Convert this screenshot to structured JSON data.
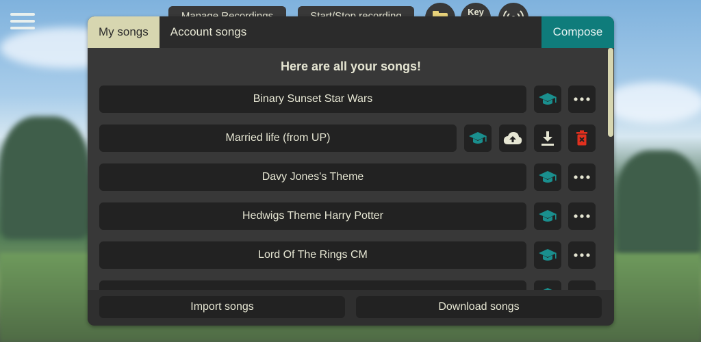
{
  "top_bar": {
    "manage_recordings": "Manage Recordings",
    "start_stop_recording": "Start/Stop recording",
    "key_label": "Key"
  },
  "tabs": {
    "my_songs": "My songs",
    "account_songs": "Account songs",
    "compose": "Compose"
  },
  "heading": "Here are all your songs!",
  "songs": [
    {
      "name": "Binary Sunset Star Wars"
    },
    {
      "name": "Married life (from UP)"
    },
    {
      "name": "Davy Jones's Theme"
    },
    {
      "name": "Hedwigs Theme Harry Potter"
    },
    {
      "name": "Lord Of The Rings CM"
    }
  ],
  "footer": {
    "import": "Import songs",
    "download": "Download songs"
  },
  "icons": {
    "learn": "graduation-cap-icon",
    "more": "more-icon",
    "upload": "cloud-upload-icon",
    "download": "download-icon",
    "delete": "trash-icon"
  },
  "colors": {
    "accent": "#0f7c7b",
    "active_tab": "#d7d6b0",
    "delete": "#e0301e",
    "panel": "#383838"
  }
}
